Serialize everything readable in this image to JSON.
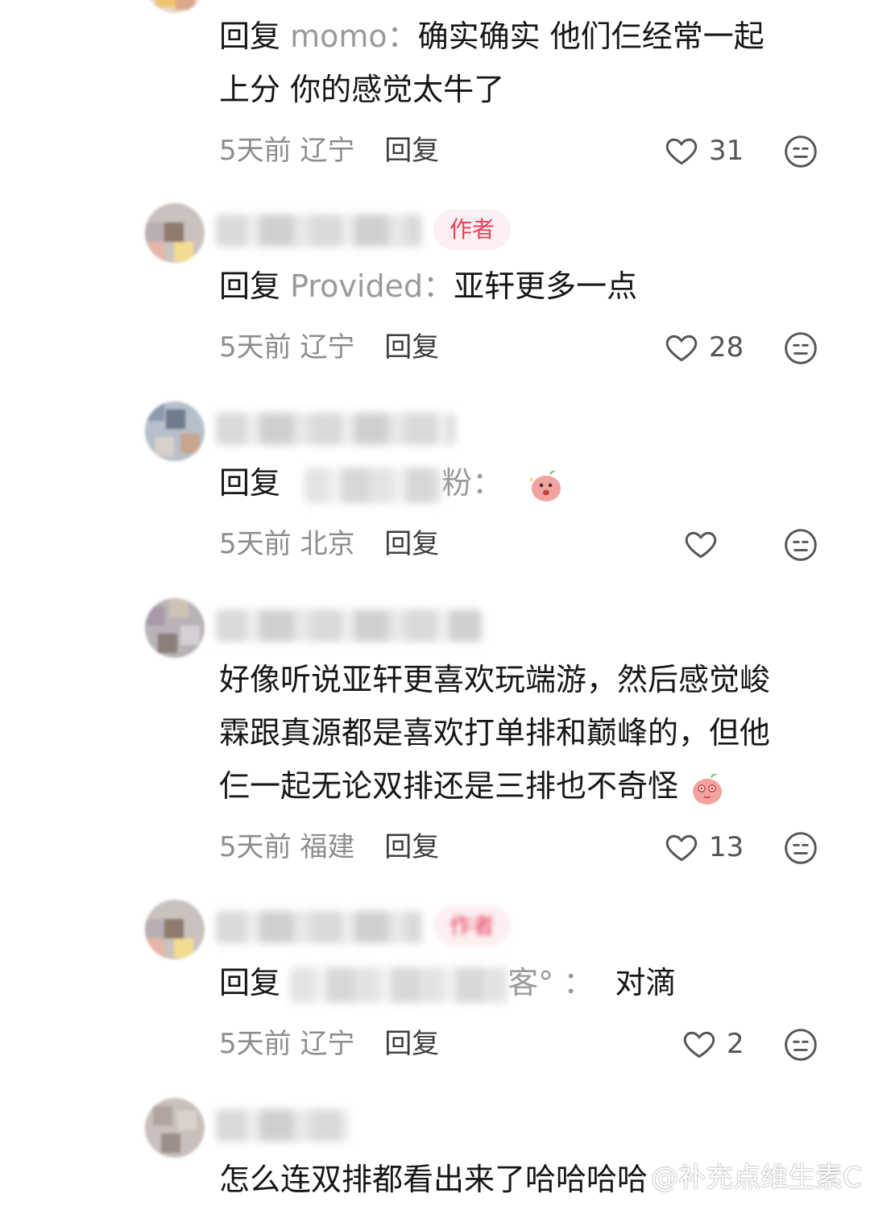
{
  "comments": [
    {
      "reply_keyword": "回复",
      "reply_to": "momo",
      "text_line1": "确实确实 他们仨经常一起",
      "text_line2": "上分 你的感觉太牛了",
      "time": "5天前",
      "location": "辽宁",
      "reply_action": "回复",
      "likes": "31"
    },
    {
      "author_tag": "作者",
      "reply_keyword": "回复",
      "reply_to": "Provided",
      "text": "亚轩更多一点",
      "time": "5天前",
      "location": "辽宁",
      "reply_action": "回复",
      "likes": "28"
    },
    {
      "reply_keyword": "回复",
      "reply_to_visible_suffix": "粉",
      "sticker": "pink-peach-sticker-icon",
      "time": "5天前",
      "location": "北京",
      "reply_action": "回复",
      "likes": ""
    },
    {
      "text_line1": "好像听说亚轩更喜欢玩端游，然后感觉峻",
      "text_line2": "霖跟真源都是喜欢打单排和巅峰的，但他",
      "text_line3": "仨一起无论双排还是三排也不奇怪",
      "sticker": "pink-peach-blush-sticker-icon",
      "time": "5天前",
      "location": "福建",
      "reply_action": "回复",
      "likes": "13"
    },
    {
      "author_tag": "作者",
      "reply_keyword": "回复",
      "reply_to_visible_suffix": "客°",
      "text": "对滴",
      "time": "5天前",
      "location": "辽宁",
      "reply_action": "回复",
      "likes": "2"
    },
    {
      "text": "怎么连双排都看出来了哈哈哈哈"
    }
  ],
  "watermark": "@补充点维生素C",
  "colors": {
    "author_tag_bg": "#fbeff1",
    "author_tag_text": "#e8405a",
    "meta_gray": "#8d8d8d",
    "reply_name_gray": "#9a9a9a"
  }
}
